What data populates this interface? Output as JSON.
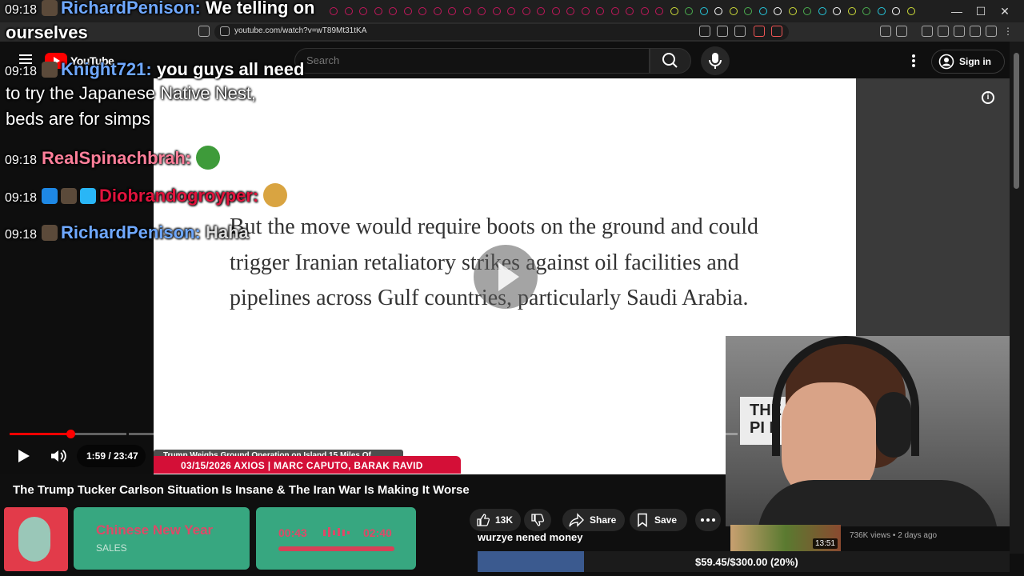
{
  "browser": {
    "url": "youtube.com/watch?v=wT89Mt31tKA",
    "window_buttons": [
      "—",
      "☐",
      "✕"
    ]
  },
  "youtube": {
    "logo_text": "YouTube",
    "search_placeholder": "Search",
    "sign_in_label": "Sign in"
  },
  "video": {
    "article_text": "But the move would require boots on the ground and could trigger Iranian retaliatory strikes against oil facilities and pipelines across Gulf countries, particularly Saudi Arabia.",
    "chapter_label": "Trump Weighs Ground Operation on Island 15 Miles Of...",
    "lower_third": "03/15/2026  AXIOS | MARC CAPUTO, BARAK RAVID",
    "time_display": "1:59 / 23:47",
    "progress_fraction": 0.083,
    "webcam_card_text": "THE PI DE"
  },
  "title": "The Trump Tucker Carlson Situation Is Insane & The Iran War Is Making It Worse",
  "actions": {
    "likes": "13K",
    "share_label": "Share",
    "save_label": "Save"
  },
  "suggested": {
    "duration": "13:51",
    "meta": "736K views • 2 days ago"
  },
  "overlay": {
    "track_title": "Chinese New Year",
    "track_subtitle": "SALES",
    "time_current": "00:43",
    "time_total": "02:40",
    "donation_message": "wurzye nened money",
    "goal_text": "$59.45/$300.00 (20%)",
    "goal_fraction": 0.2
  },
  "chat": [
    {
      "time": "09:18",
      "user": "RichardPenison",
      "color": "#6fa8ff",
      "sep": ":",
      "text": "We telling on"
    },
    {
      "continuation": "ourselves"
    },
    {
      "time": "09:18",
      "user": "Knight721",
      "color": "#6fa8ff",
      "sep": ":",
      "text": "you guys all need"
    },
    {
      "continuation": "to try the Japanese Native Nest,"
    },
    {
      "continuation": "beds are for simps"
    },
    {
      "time": "09:18",
      "user": "RealSpinachbrah",
      "color": "#ff7f9a",
      "sep": ":",
      "text": ""
    },
    {
      "time": "09:18",
      "user": "Diobrandogroyper",
      "color": "#e0133c",
      "sep": ":",
      "text": ""
    },
    {
      "time": "09:18",
      "user": "RichardPenison",
      "color": "#6fa8ff",
      "sep": ":",
      "text": "Haha"
    }
  ],
  "colors": {
    "accent": "#ff0000",
    "overlay_green": "#3bb48a",
    "overlay_pink": "#ef4f70",
    "lower_third_red": "#d40f37"
  }
}
